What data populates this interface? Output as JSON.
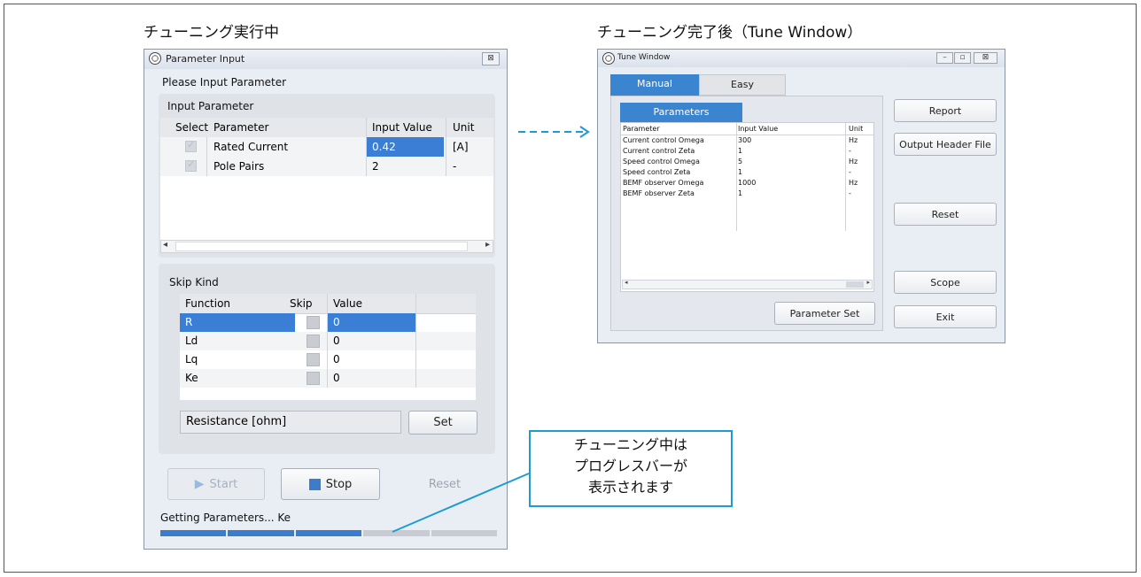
{
  "captions": {
    "left": "チューニング実行中",
    "right": "チューニング完了後（Tune Window）"
  },
  "param_window": {
    "title": "Parameter Input",
    "close_glyph": "⊠",
    "heading": "Please Input Parameter",
    "input_param": {
      "title": "Input Parameter",
      "columns": [
        "Select",
        "Parameter",
        "Input Value",
        "Unit"
      ],
      "rows": [
        {
          "selected": true,
          "parameter": "Rated Current",
          "value": "0.42",
          "unit": "[A]"
        },
        {
          "selected": true,
          "parameter": "Pole Pairs",
          "value": "2",
          "unit": "-"
        }
      ],
      "scroll_left": "◂",
      "scroll_right": "▸"
    },
    "skip_kind": {
      "title": "Skip Kind",
      "columns": [
        "Function",
        "Skip",
        "Value"
      ],
      "rows": [
        {
          "function": "R",
          "value": "0"
        },
        {
          "function": "Ld",
          "value": "0"
        },
        {
          "function": "Lq",
          "value": "0"
        },
        {
          "function": "Ke",
          "value": "0"
        }
      ],
      "field": "Resistance [ohm]",
      "set_label": "Set"
    },
    "start_label": "Start",
    "stop_label": "Stop",
    "reset_label": "Reset",
    "status": "Getting Parameters... Ke",
    "progress_fraction": 0.6
  },
  "tune_window": {
    "title": "Tune Window",
    "tabs": [
      "Manual",
      "Easy"
    ],
    "active_tab": "Manual",
    "subtab": "Parameters",
    "columns": [
      "Parameter",
      "Input Value",
      "Unit"
    ],
    "rows": [
      {
        "parameter": "Current control Omega",
        "value": "300",
        "unit": "Hz"
      },
      {
        "parameter": "Current control Zeta",
        "value": "1",
        "unit": "-"
      },
      {
        "parameter": "Speed control Omega",
        "value": "5",
        "unit": "Hz"
      },
      {
        "parameter": "Speed control Zeta",
        "value": "1",
        "unit": "-"
      },
      {
        "parameter": "BEMF observer Omega",
        "value": "1000",
        "unit": "Hz"
      },
      {
        "parameter": "BEMF observer Zeta",
        "value": "1",
        "unit": "-"
      }
    ],
    "parameter_set_label": "Parameter Set",
    "side_buttons": {
      "report": "Report",
      "output_header": "Output Header File",
      "reset": "Reset",
      "scope": "Scope",
      "exit": "Exit"
    },
    "window_controls": [
      "–",
      "▫",
      "⊠"
    ],
    "scroll_left": "◂",
    "scroll_right": "▸"
  },
  "callout": {
    "lines": [
      "チューニング中は",
      "プログレスバーが",
      "表示されます"
    ]
  },
  "colors": {
    "selection": "#3a7fd5",
    "accent": "#3b84cf",
    "progress": "#3b7ccd",
    "callout_border": "#1e9ad6",
    "arrow": "#1e9ad6"
  }
}
